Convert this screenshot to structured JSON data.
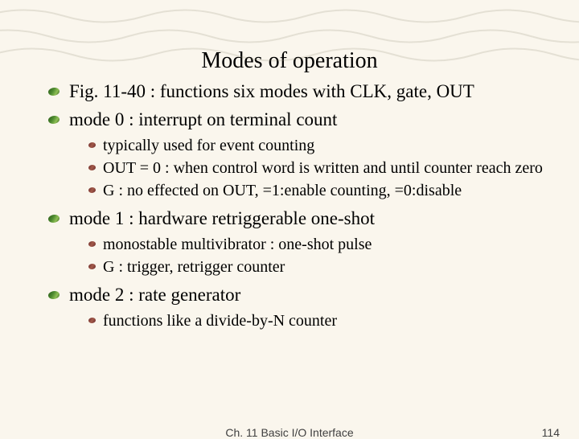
{
  "title": "Modes of operation",
  "bullets": {
    "fig": "Fig. 11-40 : functions six modes with CLK, gate, OUT",
    "mode0": "mode 0 : interrupt on terminal count",
    "mode0_sub": {
      "a": "typically used for event counting",
      "b": "OUT = 0 : when control word is written and until counter reach zero",
      "c": "G : no effected on OUT, =1:enable counting, =0:disable"
    },
    "mode1": "mode 1 : hardware retriggerable one-shot",
    "mode1_sub": {
      "a": "monostable multivibrator : one-shot pulse",
      "b": "G : trigger, retrigger counter"
    },
    "mode2": "mode 2 : rate generator",
    "mode2_sub": {
      "a": "functions like a divide-by-N counter"
    }
  },
  "footer": {
    "chapter": "Ch. 11 Basic I/O Interface",
    "page": "114"
  }
}
